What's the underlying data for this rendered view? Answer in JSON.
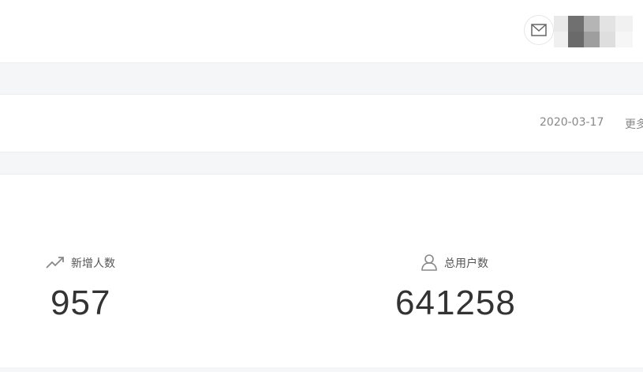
{
  "header": {
    "message_icon": "mail-icon",
    "avatar_icon": "user-avatar-icon"
  },
  "notice": {
    "date": "2020-03-17",
    "more_label": "更多"
  },
  "stats": [
    {
      "icon": "trend-up-icon",
      "label": "新增人数",
      "value": "957"
    },
    {
      "icon": "user-icon",
      "label": "总用户数",
      "value": "641258"
    }
  ],
  "colors": {
    "page_bg": "#f5f6f8",
    "card_bg": "#ffffff",
    "muted_text": "#888888",
    "value_text": "#333333"
  }
}
